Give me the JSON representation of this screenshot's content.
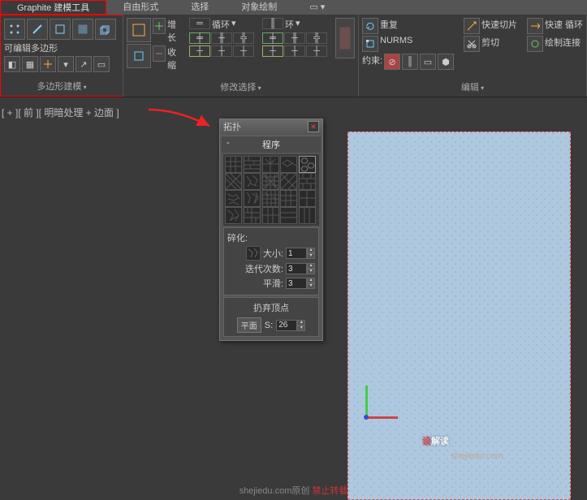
{
  "tabs": {
    "graphite": "Graphite 建模工具",
    "freeform": "自由形式",
    "select": "选择",
    "paint": "对象绘制"
  },
  "panels": {
    "editable_poly": "可编辑多边形",
    "poly_model": "多边形建模",
    "grow": "增长",
    "shrink": "收缩",
    "loop": "循环",
    "ring": "环",
    "modify_sel": "修改选择",
    "repeat": "重复",
    "nurms": "NURMS",
    "constrain": "约束:",
    "quick_slice": "快速切片",
    "cut": "剪切",
    "edit": "编辑",
    "quick_loop": "快速 循环",
    "paint_connect": "绘制连接"
  },
  "viewport_label": "[ + ][ 前 ][ 明暗处理 + 边面 ]",
  "dialog": {
    "title": "拓扑",
    "section": "程序",
    "fragment_label": "碎化:",
    "size_label": "大小:",
    "size_val": "1",
    "iter_label": "迭代次数:",
    "iter_val": "3",
    "smooth_label": "平滑:",
    "smooth_val": "3",
    "discard_title": "扔弃顶点",
    "plane_btn": "平面",
    "s_label": "S:",
    "s_val": "26"
  },
  "watermark": {
    "red": "设",
    "white": "解读",
    "sub": "shejiedu.com"
  },
  "footer": {
    "grey": "shejiedu.com原创 ",
    "red": "禁止转载"
  }
}
